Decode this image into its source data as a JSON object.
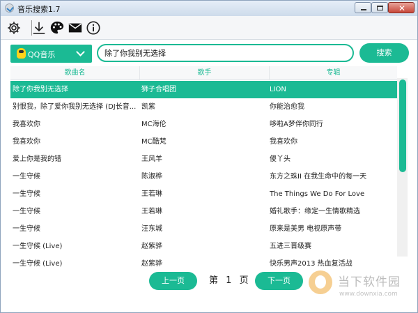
{
  "window": {
    "title": "音乐搜索1.7"
  },
  "toolbar": {
    "icons": [
      "gear-icon",
      "download-icon",
      "palette-icon",
      "mail-icon",
      "info-icon"
    ]
  },
  "search": {
    "source": "QQ音乐",
    "query": "除了你我别无选择",
    "button": "搜索"
  },
  "table": {
    "columns": [
      "歌曲名",
      "歌手",
      "专辑"
    ],
    "rows": [
      {
        "song": "除了你我别无选择",
        "artist": "狮子合唱团",
        "album": "LION",
        "selected": true
      },
      {
        "song": "别恨我，除了爱你我别无选择 (DJ长音...",
        "artist": "凯紫",
        "album": "你能治愈我"
      },
      {
        "song": "我喜欢你",
        "artist": "MC海伦",
        "album": "哆啦A梦伴你同行"
      },
      {
        "song": "我喜欢你",
        "artist": "MC酷梵",
        "album": "我喜欢你"
      },
      {
        "song": "爱上你是我的错",
        "artist": "王风羊",
        "album": "傻丫头"
      },
      {
        "song": "一生守候",
        "artist": "陈淑桦",
        "album": "东方之珠II 在我生命中的每一天"
      },
      {
        "song": "一生守候",
        "artist": "王若琳",
        "album": "The Things We Do For Love"
      },
      {
        "song": "一生守候",
        "artist": "王若琳",
        "album": "婚礼歌手：缘定一生情歌精选"
      },
      {
        "song": "一生守候",
        "artist": "汪东城",
        "album": "原来是美男 电视原声带"
      },
      {
        "song": "一生守候 (Live)",
        "artist": "赵紫骅",
        "album": "五进三晋级赛"
      },
      {
        "song": "一生守候 (Live)",
        "artist": "赵紫骅",
        "album": "快乐男声2013 热血复活战"
      }
    ]
  },
  "pager": {
    "prev": "上一页",
    "label_pre": "第",
    "page": "1",
    "label_post": "页",
    "next": "下一页"
  },
  "watermark": {
    "name": "当下软件园",
    "url": "www.downxia.com"
  },
  "colors": {
    "accent": "#1bba94"
  }
}
